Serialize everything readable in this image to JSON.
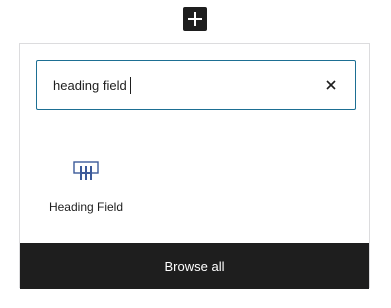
{
  "toolbar": {
    "add_icon": "plus-icon"
  },
  "inserter": {
    "search": {
      "value": "heading field",
      "clear_icon": "close-icon"
    },
    "results": [
      {
        "label": "Heading Field",
        "icon": "heading-field-block-icon",
        "icon_color": "#3c5a9a"
      }
    ],
    "browse_all_label": "Browse all"
  },
  "colors": {
    "accent": "#1d6f93",
    "dark": "#1e1e1e",
    "border": "#dcdcde"
  }
}
